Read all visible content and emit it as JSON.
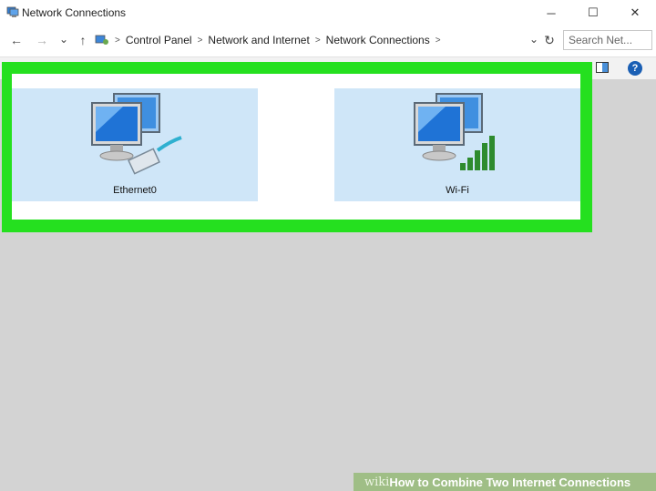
{
  "window": {
    "title": "Network Connections",
    "buttons": {
      "minimize": "─",
      "maximize": "☐",
      "close": "✕"
    }
  },
  "addressbar": {
    "back": "←",
    "forward": "→",
    "recent": "⌄",
    "up": "↑",
    "breadcrumbs": [
      "Control Panel",
      "Network and Internet",
      "Network Connections"
    ],
    "separator": ">",
    "dropdown": "⌄",
    "refresh": "↻",
    "search_placeholder": "Search Net..."
  },
  "toolbar": {
    "help": "?"
  },
  "connections": [
    {
      "name": "Ethernet0",
      "icon": "ethernet-adapter-icon"
    },
    {
      "name": "Wi-Fi",
      "icon": "wifi-adapter-icon"
    }
  ],
  "highlight_color": "#25e01f",
  "watermark": {
    "wiki": "wiki",
    "how": "How",
    "rest": " to Combine Two Internet Connections"
  }
}
